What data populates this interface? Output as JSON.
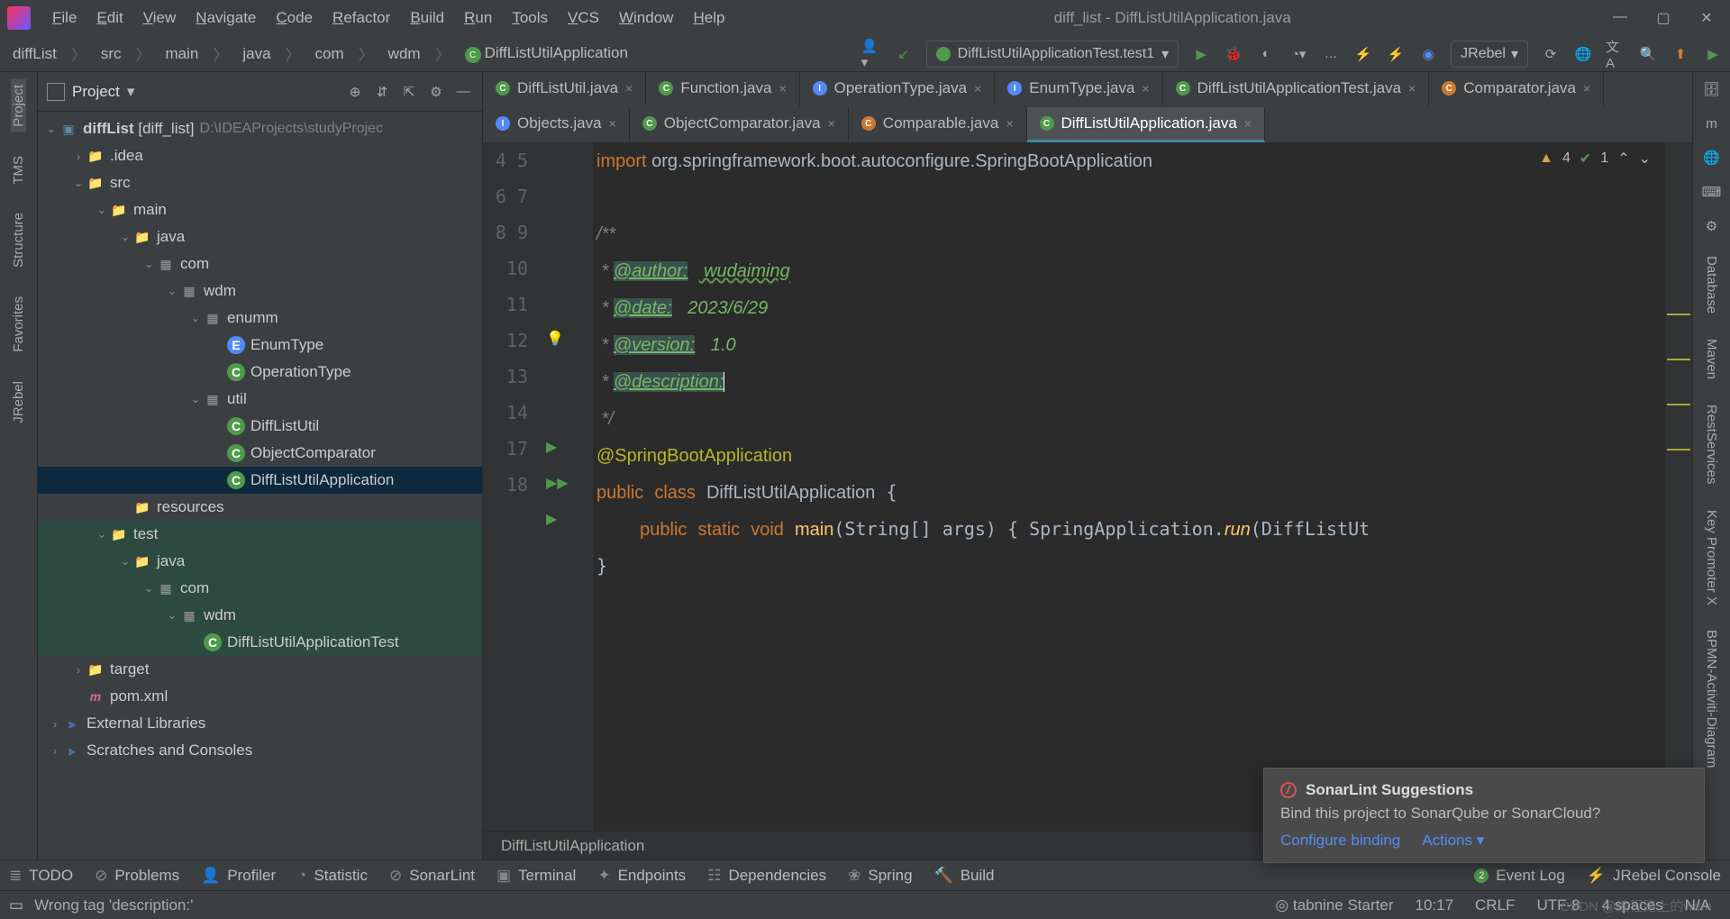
{
  "menu": {
    "items": [
      "File",
      "Edit",
      "View",
      "Navigate",
      "Code",
      "Refactor",
      "Build",
      "Run",
      "Tools",
      "VCS",
      "Window",
      "Help"
    ],
    "underline": [
      "F",
      "E",
      "V",
      "N",
      "C",
      "R",
      "B",
      "R",
      "T",
      "V",
      "W",
      "H"
    ]
  },
  "title": "diff_list - DiffListUtilApplication.java",
  "breadcrumbs": [
    "diffList",
    "src",
    "main",
    "java",
    "com",
    "wdm",
    "DiffListUtilApplication"
  ],
  "run_config": "DiffListUtilApplicationTest.test1",
  "jrebel_label": "JRebel",
  "project": {
    "label": "Project",
    "root_name": "diffList",
    "root_suffix": "[diff_list]",
    "root_path": "D:\\IDEAProjects\\studyProjec",
    "nodes": [
      {
        "d": 1,
        "tw": ">",
        "icon": "dir",
        "label": ".idea"
      },
      {
        "d": 1,
        "tw": "v",
        "icon": "dir-blue",
        "label": "src"
      },
      {
        "d": 2,
        "tw": "v",
        "icon": "dir-blue",
        "label": "main"
      },
      {
        "d": 3,
        "tw": "v",
        "icon": "dir-blue",
        "label": "java"
      },
      {
        "d": 4,
        "tw": "v",
        "icon": "pkg",
        "label": "com"
      },
      {
        "d": 5,
        "tw": "v",
        "icon": "pkg",
        "label": "wdm"
      },
      {
        "d": 6,
        "tw": "v",
        "icon": "pkg",
        "label": "enumm"
      },
      {
        "d": 7,
        "tw": "",
        "icon": "cls-b",
        "label": "EnumType"
      },
      {
        "d": 7,
        "tw": "",
        "icon": "cls",
        "label": "OperationType"
      },
      {
        "d": 6,
        "tw": "v",
        "icon": "pkg",
        "label": "util"
      },
      {
        "d": 7,
        "tw": "",
        "icon": "cls",
        "label": "DiffListUtil"
      },
      {
        "d": 7,
        "tw": "",
        "icon": "cls",
        "label": "ObjectComparator"
      },
      {
        "d": 7,
        "tw": "",
        "icon": "cls",
        "label": "DiffListUtilApplication",
        "sel": true
      },
      {
        "d": 3,
        "tw": "",
        "icon": "dir",
        "label": "resources"
      },
      {
        "d": 2,
        "tw": "v",
        "icon": "dir-blue",
        "label": "test",
        "rng": true
      },
      {
        "d": 3,
        "tw": "v",
        "icon": "dir-blue",
        "label": "java",
        "rng": true
      },
      {
        "d": 4,
        "tw": "v",
        "icon": "pkg",
        "label": "com",
        "rng": true
      },
      {
        "d": 5,
        "tw": "v",
        "icon": "pkg",
        "label": "wdm",
        "rng": true
      },
      {
        "d": 6,
        "tw": "",
        "icon": "cls",
        "label": "DiffListUtilApplicationTest",
        "rng": true
      },
      {
        "d": 1,
        "tw": ">",
        "icon": "tgt",
        "label": "target"
      },
      {
        "d": 1,
        "tw": "",
        "icon": "m",
        "label": "pom.xml"
      }
    ],
    "ext_libs": "External Libraries",
    "scratches": "Scratches and Consoles"
  },
  "tabs": [
    {
      "l": "DiffListUtil.java",
      "i": "g"
    },
    {
      "l": "Function.java",
      "i": "g"
    },
    {
      "l": "OperationType.java",
      "i": "b"
    },
    {
      "l": "EnumType.java",
      "i": "b"
    },
    {
      "l": "DiffListUtilApplicationTest.java",
      "i": "g"
    },
    {
      "l": "Comparator.java",
      "i": "o"
    },
    {
      "l": "Objects.java",
      "i": "b"
    },
    {
      "l": "ObjectComparator.java",
      "i": "g"
    },
    {
      "l": "Comparable.java",
      "i": "o"
    },
    {
      "l": "DiffListUtilApplication.java",
      "i": "g",
      "active": true
    }
  ],
  "code": {
    "lines": [
      "4",
      "5",
      "6",
      "7",
      "8",
      "9",
      "10",
      "11",
      "12",
      "13",
      "14",
      "17",
      "18"
    ],
    "import_kw": "import",
    "import_pkg": " org.springframework.boot.autoconfigure.",
    "import_cls": "SpringBootApplication",
    "doc_open": "/**",
    "doc_star": " * ",
    "tag_author": "@author:",
    "val_author": "wudaiming",
    "tag_date": "@date:",
    "val_date": "2023/6/29",
    "tag_version": "@version:",
    "val_version": "1.0",
    "tag_desc": "@description:",
    "doc_close": " */",
    "ann": "@SpringBootApplication",
    "cls_decl_pub": "public",
    "cls_decl_class": "class",
    "cls_name": "DiffListUtilApplication",
    "main_pub": "public",
    "main_static": "static",
    "main_void": "void",
    "main_name": "main",
    "main_args": "(String[] args) { SpringApplication.",
    "main_run": "run",
    "main_tail": "(DiffListUt",
    "close_brace": "}"
  },
  "inspections": {
    "warn": "4",
    "ok": "1"
  },
  "bcrumb": "DiffListUtilApplication",
  "popup": {
    "title": "SonarLint Suggestions",
    "body": "Bind this project to SonarQube or SonarCloud?",
    "link1": "Configure binding",
    "link2": "Actions"
  },
  "bottom_tw": [
    "TODO",
    "Problems",
    "Profiler",
    "Statistic",
    "SonarLint",
    "Terminal",
    "Endpoints",
    "Dependencies",
    "Spring",
    "Build"
  ],
  "event_log": "Event Log",
  "event_badge": "2",
  "jconsole": "JRebel Console",
  "status": {
    "msg": "Wrong tag 'description:'",
    "tabnine": "tabnine Starter",
    "pos": "10:17",
    "eol": "CRLF",
    "enc": "UTF-8",
    "indent": "4 spaces",
    "tail": "N/A"
  },
  "left_tools": [
    "Project",
    "TMS",
    "Structure",
    "Favorites",
    "JRebel"
  ],
  "right_tools": [
    "Database",
    "Maven",
    "RestServices",
    "Key Promoter X",
    "BPMN-Activiti-Diagram"
  ],
  "watermark": "CSDN @编程路上的wdm"
}
